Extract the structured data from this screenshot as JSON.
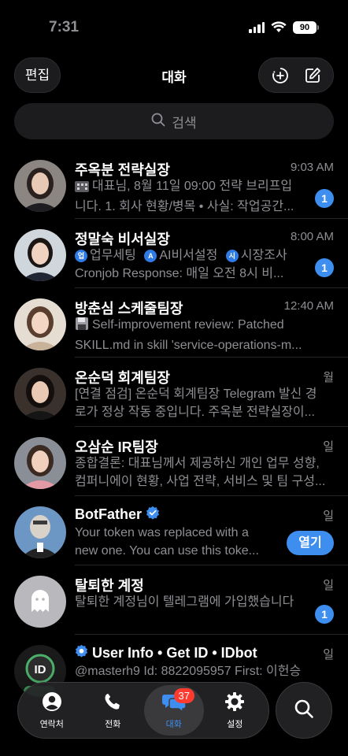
{
  "status_bar": {
    "time": "7:31",
    "battery": "90"
  },
  "header": {
    "edit_label": "편집",
    "title": "대화"
  },
  "search": {
    "placeholder": "검색"
  },
  "chats": [
    {
      "name": "주옥분 전략실장",
      "time": "9:03 AM",
      "line1": "대표님, 8월 11일 09:00 전략 브리프입",
      "line2": "니다. 1. 회사 현황/병목 • 사실: 작업공간...",
      "unread": "1",
      "avatar_color": "#5a4a44"
    },
    {
      "name": "정말숙 비서실장",
      "time": "8:00 AM",
      "tags": [
        "업무세팅",
        "AI비서설정",
        "시장조사"
      ],
      "tag_letters": [
        "업",
        "A",
        "시"
      ],
      "line2": "Cronjob Response: 매일 오전 8시 비...",
      "unread": "1",
      "avatar_color": "#4b5a6a"
    },
    {
      "name": "방춘심 스케줄팀장",
      "time": "12:40 AM",
      "line1": "Self-improvement review: Patched",
      "line2": "SKILL.md in skill 'service-operations-m...",
      "avatar_color": "#a48b78"
    },
    {
      "name": "온순덕 회계팀장",
      "time": "월",
      "line1": "[연결 점검] 온순덕 회계팀장 Telegram 발신 경",
      "line2": "로가 정상 작동 중입니다. 주옥분 전략실장이...",
      "avatar_color": "#3e3431"
    },
    {
      "name": "오삼순 IR팀장",
      "time": "일",
      "line1": "종합결론: 대표님께서 제공하신 개인 업무 성향,",
      "line2": "컴퍼니에이 현황, 사업 전략, 서비스 및 팀 구성...",
      "avatar_color": "#c98a8f"
    },
    {
      "name": "BotFather",
      "time": "일",
      "line1": "Your token was replaced with a",
      "line2": "new one. You can use this toke...",
      "action": "열기",
      "verified": true,
      "avatar_color": "#4f7fae"
    },
    {
      "name": "탈퇴한 계정",
      "time": "일",
      "line1": "탈퇴한 계정님이 텔레그램에 가입했습니다",
      "unread": "1",
      "avatar_color": "#b9b9bd"
    },
    {
      "name": "User Info • Get ID • IDbot",
      "time": "일",
      "line1": "@masterh9 Id: 8822095957 First: 이헌승",
      "avatar_color": "#1d2b24"
    }
  ],
  "tabbar": {
    "tabs": [
      {
        "label": "연락처",
        "icon": "person-icon"
      },
      {
        "label": "전화",
        "icon": "phone-icon"
      },
      {
        "label": "대화",
        "icon": "chat-bubbles-icon",
        "badge": "37",
        "active": true
      },
      {
        "label": "설정",
        "icon": "gear-icon"
      }
    ]
  },
  "colors": {
    "accent": "#3e8ef0",
    "background": "#000000",
    "badge_red": "#ff3b30"
  }
}
